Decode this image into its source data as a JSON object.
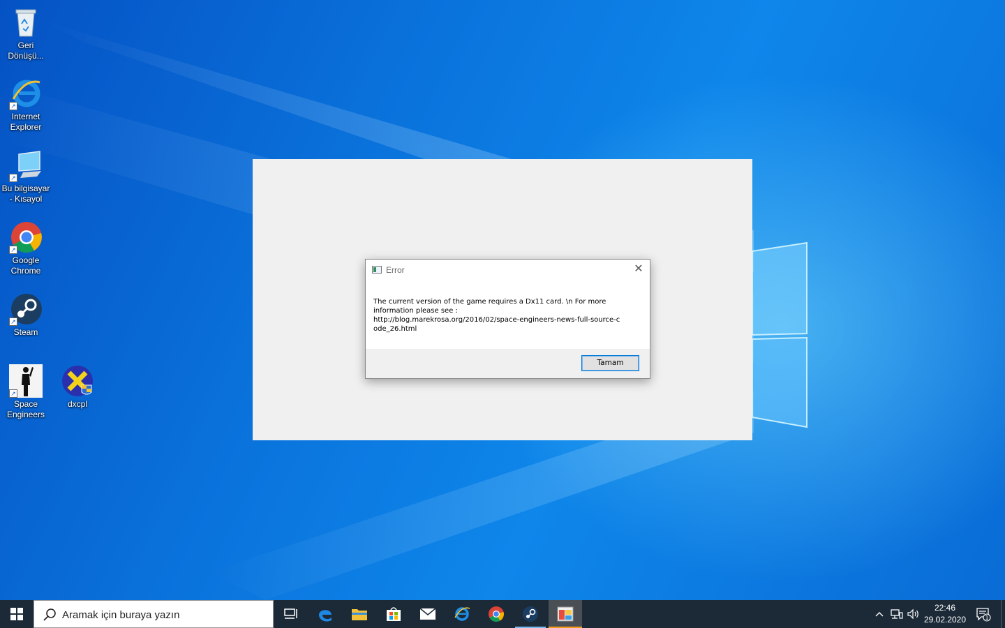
{
  "desktop_icons": [
    {
      "id": "recycle-bin",
      "label": "Geri\nDönüşü...",
      "icon": "recycle-bin-icon",
      "shortcut": false
    },
    {
      "id": "internet-explorer",
      "label": "Internet\nExplorer",
      "icon": "internet-explorer-icon",
      "shortcut": true
    },
    {
      "id": "this-pc",
      "label": "Bu bilgisayar\n- Kısayol",
      "icon": "computer-icon",
      "shortcut": true
    },
    {
      "id": "google-chrome",
      "label": "Google\nChrome",
      "icon": "chrome-icon",
      "shortcut": true
    },
    {
      "id": "steam",
      "label": "Steam",
      "icon": "steam-icon",
      "shortcut": true
    },
    {
      "id": "space-engineers",
      "label": "Space\nEngineers",
      "icon": "space-engineers-icon",
      "shortcut": true
    },
    {
      "id": "dxcpl",
      "label": "dxcpl",
      "icon": "dxcpl-icon",
      "shortcut": false
    }
  ],
  "dialog": {
    "title": "Error",
    "message": "The current version of the game requires a Dx11 card. \\n For more\ninformation please see :\nhttp://blog.marekrosa.org/2016/02/space-engineers-news-full-source-c\node_26.html",
    "ok_label": "Tamam",
    "close_icon": "close-icon"
  },
  "taskbar": {
    "search_placeholder": "Aramak için buraya yazın",
    "pinned": [
      {
        "id": "task-view",
        "icon": "task-view-icon"
      },
      {
        "id": "edge",
        "icon": "edge-icon"
      },
      {
        "id": "file-explorer",
        "icon": "folder-icon"
      },
      {
        "id": "store",
        "icon": "store-icon"
      },
      {
        "id": "mail",
        "icon": "mail-icon"
      },
      {
        "id": "internet-explorer",
        "icon": "internet-explorer-icon"
      },
      {
        "id": "chrome",
        "icon": "chrome-icon"
      },
      {
        "id": "steam",
        "icon": "steam-icon",
        "running": true
      },
      {
        "id": "space-engineers",
        "icon": "game-window-icon",
        "active": true
      }
    ],
    "tray": {
      "time": "22:46",
      "date": "29.02.2020",
      "notification_count": "1"
    }
  },
  "colors": {
    "desktop_blue": "#0a6fd8",
    "taskbar": "#1c2a38",
    "active_indicator": "#f59b1c",
    "button_focus_border": "#0078d7"
  }
}
